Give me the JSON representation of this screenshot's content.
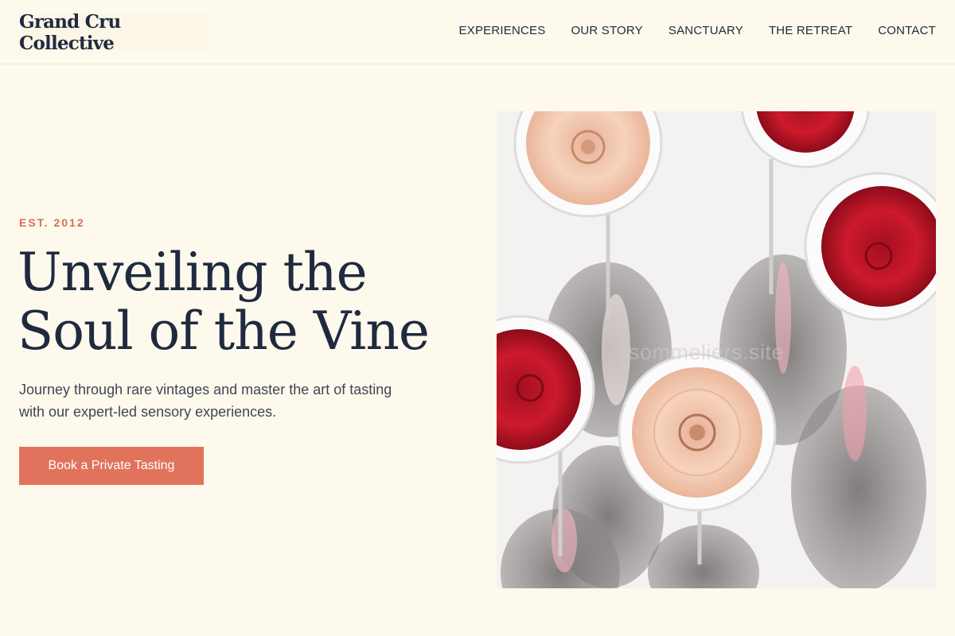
{
  "header": {
    "logo": "Grand Cru Collective",
    "nav": [
      "EXPERIENCES",
      "OUR STORY",
      "SANCTUARY",
      "THE RETREAT",
      "CONTACT"
    ]
  },
  "hero": {
    "eyebrow": "EST. 2012",
    "headline_line1": "Unveiling the",
    "headline_line2": "Soul of the Vine",
    "lede": "Journey through rare vintages and master the art of tasting with our expert-led sensory experiences.",
    "cta": "Book a Private Tasting",
    "image_watermark": "sommeliers.site"
  },
  "colors": {
    "background": "#fdf9ec",
    "accent": "#e1735d",
    "eyebrow": "#d86f59",
    "text": "#1f2a3f",
    "red_wine": "#c11628",
    "rose_wine": "#f0c2a8"
  }
}
